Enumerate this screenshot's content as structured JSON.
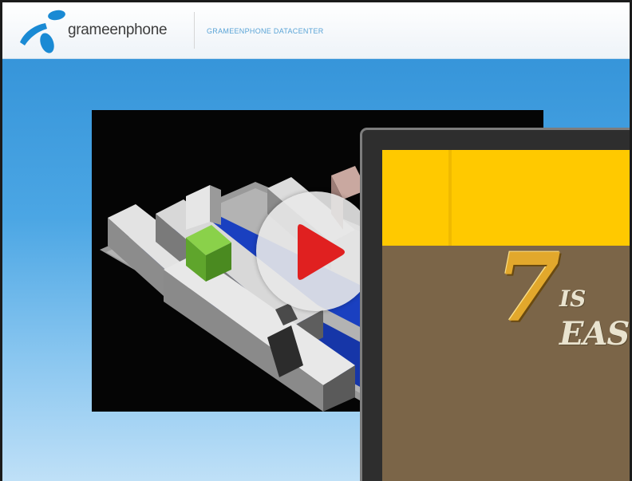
{
  "header": {
    "brand_name": "grameenphone",
    "subtitle": "GRAMEENPHONE DATACENTER",
    "logo_icon": "grameenphone-logo-icon",
    "brand_color": "#1a8ad4"
  },
  "main": {
    "video_thumbnail": "datacenter-3d-render",
    "play_icon": "play-icon",
    "play_color": "#e02020"
  },
  "popup": {
    "number": "7",
    "word_small": "IS",
    "word_large": "EAS",
    "top_band_color": "#ffc900",
    "panel_color": "#7b6548"
  }
}
